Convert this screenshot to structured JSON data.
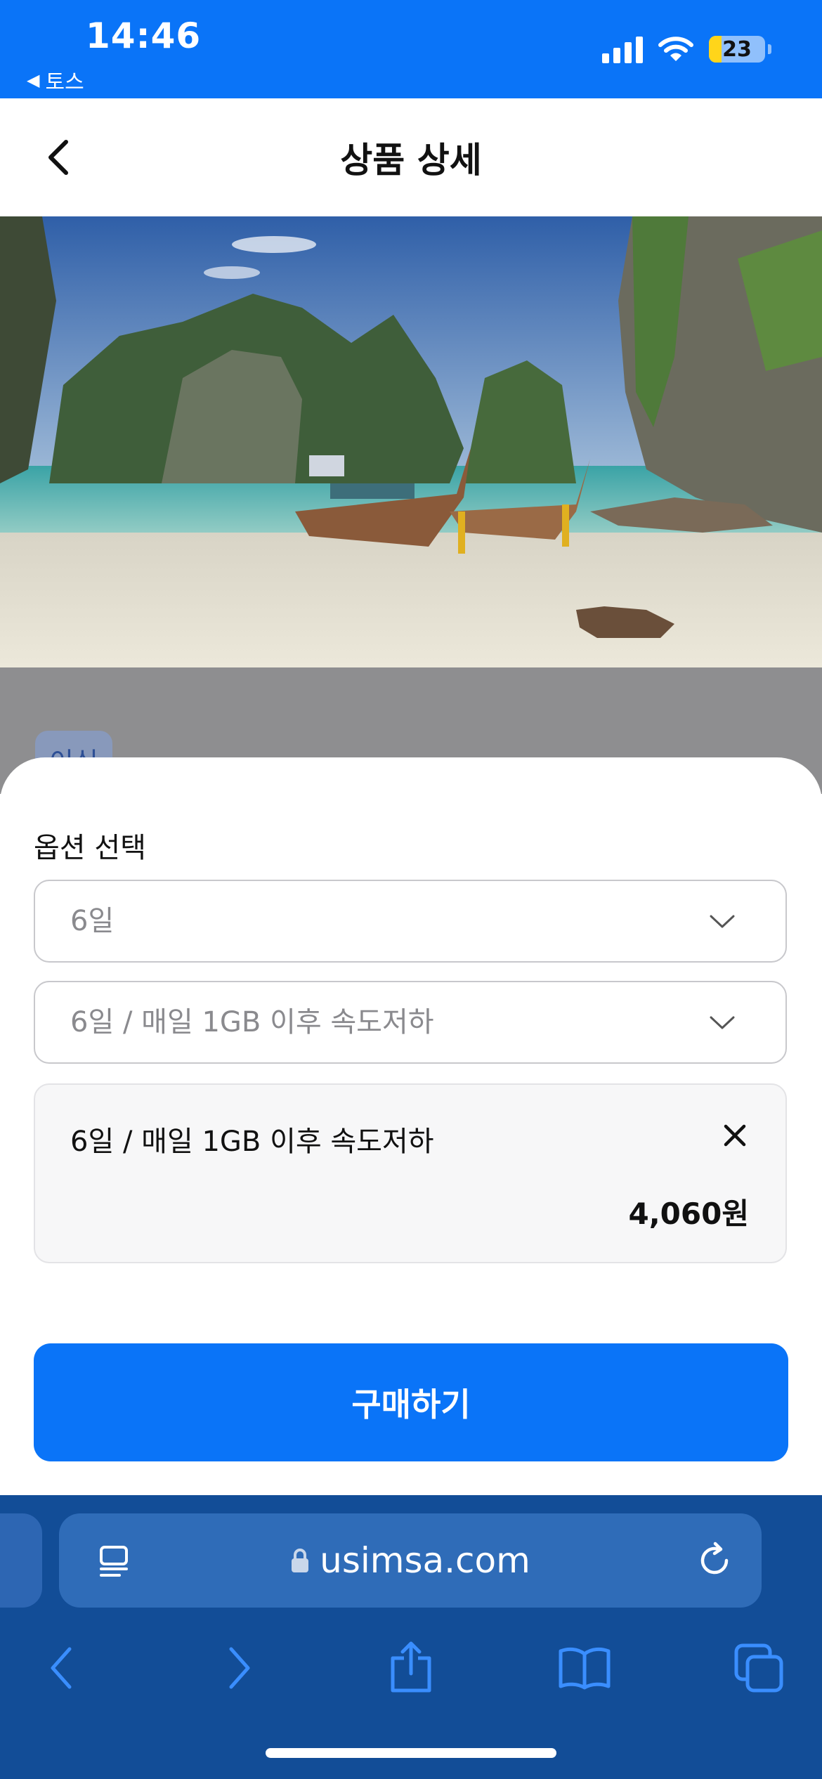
{
  "status_bar": {
    "time": "14:46",
    "back_app": "토스",
    "battery_level": "23",
    "icons": [
      "signal-icon",
      "wifi-icon",
      "battery-icon"
    ]
  },
  "header": {
    "title": "상품 상세",
    "back_icon": "chevron-left-icon"
  },
  "background_content": {
    "tag": "이심"
  },
  "option_sheet": {
    "label": "옵션 선택",
    "selects": [
      {
        "value": "6일",
        "icon": "chevron-down-icon"
      },
      {
        "value": "6일 / 매일 1GB 이후 속도저하",
        "icon": "chevron-down-icon"
      }
    ],
    "selected_item": {
      "name": "6일 / 매일 1GB 이후 속도저하",
      "price": "4,060원",
      "remove_icon": "close-icon"
    },
    "buy_button": "구매하기"
  },
  "browser": {
    "url": "usimsa.com",
    "icons": [
      "reader-icon",
      "lock-icon",
      "reload-icon",
      "back-icon",
      "forward-icon",
      "share-icon",
      "bookmarks-icon",
      "tabs-icon"
    ]
  },
  "colors": {
    "accent": "#0A74F8",
    "browser_bar": "#124D97"
  }
}
